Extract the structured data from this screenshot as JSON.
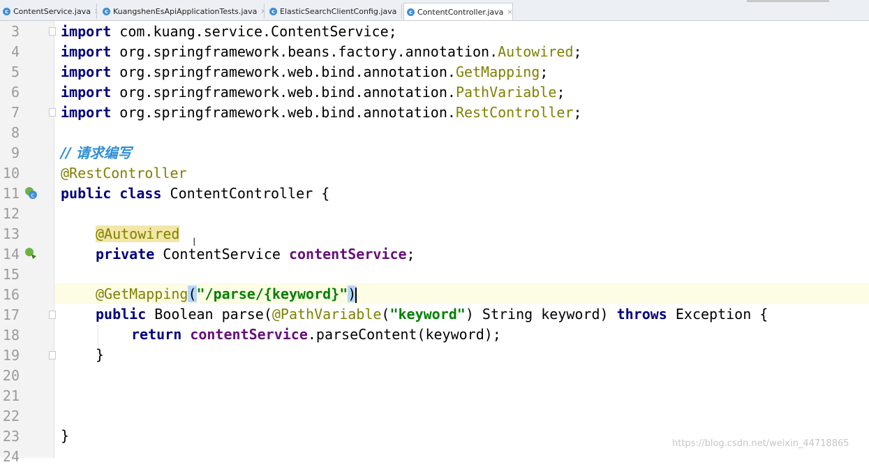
{
  "tabs": [
    {
      "label": "ContentService.java",
      "icon": "class-icon"
    },
    {
      "label": "KuangshenEsApiApplicationTests.java",
      "icon": "class-icon"
    },
    {
      "label": "ElasticSearchClientConfig.java",
      "icon": "class-icon"
    },
    {
      "label": "ContentController.java",
      "icon": "class-icon",
      "active": true
    }
  ],
  "tab_close_glyph": "×",
  "line_numbers": [
    "3",
    "4",
    "5",
    "6",
    "7",
    "8",
    "9",
    "10",
    "11",
    "12",
    "13",
    "14",
    "15",
    "16",
    "17",
    "18",
    "19",
    "20",
    "21",
    "22",
    "23",
    "24"
  ],
  "code": {
    "l3": {
      "kw": "import",
      "rest": " com.kuang.service.ContentService;"
    },
    "l4": {
      "kw": "import",
      "pkg": " org.springframework.beans.factory.annotation.",
      "cls": "Autowired",
      "end": ";"
    },
    "l5": {
      "kw": "import",
      "pkg": " org.springframework.web.bind.annotation.",
      "cls": "GetMapping",
      "end": ";"
    },
    "l6": {
      "kw": "import",
      "pkg": " org.springframework.web.bind.annotation.",
      "cls": "PathVariable",
      "end": ";"
    },
    "l7": {
      "kw": "import",
      "pkg": " org.springframework.web.bind.annotation.",
      "cls": "RestController",
      "end": ";"
    },
    "l9": {
      "comment": "// 请求编写"
    },
    "l10": {
      "ann": "@RestController"
    },
    "l11": {
      "kw1": "public",
      "kw2": "class",
      "rest": " ContentController {"
    },
    "l13": {
      "ann": "@Autowired"
    },
    "l14": {
      "kw": "private",
      "type": " ContentService ",
      "field": "contentService",
      "end": ";"
    },
    "l16": {
      "ann": "@GetMapping",
      "open": "(",
      "str": "\"/parse/{keyword}\"",
      "close": ")"
    },
    "l17": {
      "kw": "public",
      "a": " Boolean parse(",
      "ann": "@PathVariable",
      "b": "(",
      "str": "\"keyword\"",
      "c": ") String keyword) ",
      "kw2": "throws",
      "d": " Exception {"
    },
    "l18": {
      "kw": "return",
      "sp": " ",
      "field": "contentService",
      "rest": ".parseContent(keyword);"
    },
    "l19": {
      "rest": "}"
    },
    "l23": {
      "rest": "}"
    }
  },
  "watermark": "https://blog.csdn.net/weixin_44718865",
  "colors": {
    "keyword": "#000080",
    "annotation": "#808000",
    "field": "#660e7a",
    "string": "#008000",
    "comment": "#2f8fd6"
  }
}
